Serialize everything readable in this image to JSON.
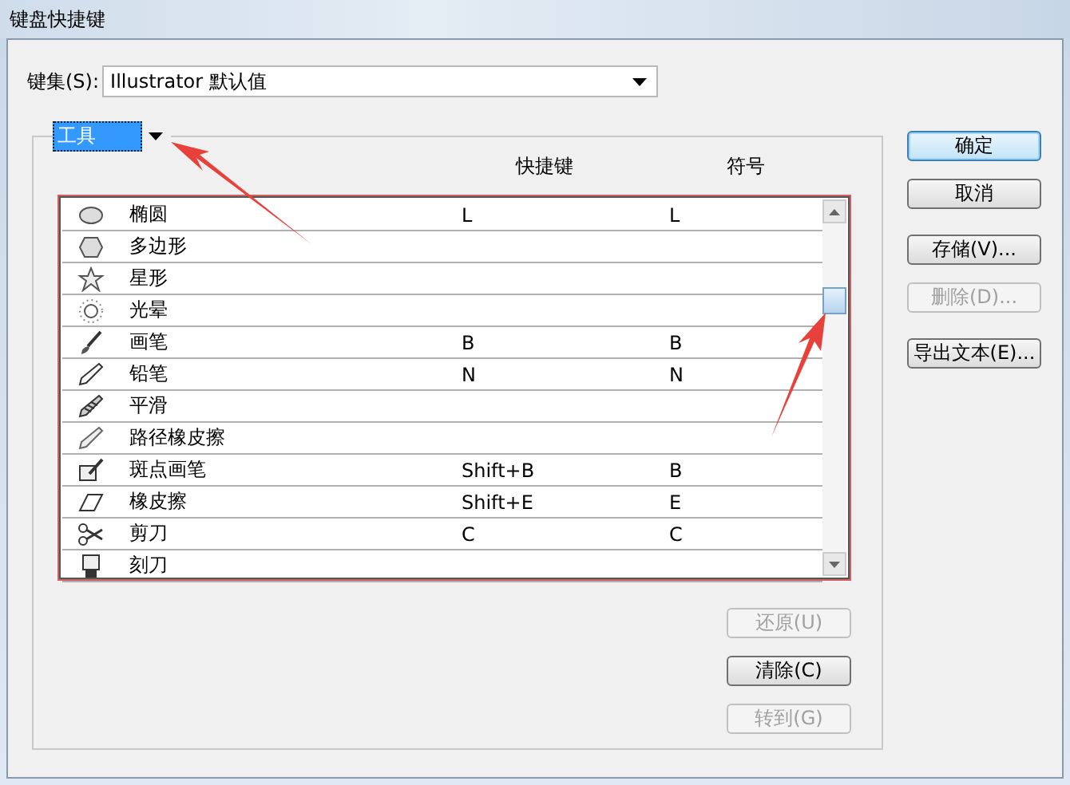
{
  "window": {
    "title": "键盘快捷键"
  },
  "keyset": {
    "label": "键集(S):",
    "value": "Illustrator 默认值"
  },
  "category": {
    "value": "工具"
  },
  "columns": [
    "快捷键",
    "符号"
  ],
  "rows": [
    {
      "name": "椭圆",
      "shortcut": "L",
      "symbol": "L"
    },
    {
      "name": "多边形",
      "shortcut": "",
      "symbol": ""
    },
    {
      "name": "星形",
      "shortcut": "",
      "symbol": ""
    },
    {
      "name": "光晕",
      "shortcut": "",
      "symbol": ""
    },
    {
      "name": "画笔",
      "shortcut": "B",
      "symbol": "B"
    },
    {
      "name": "铅笔",
      "shortcut": "N",
      "symbol": "N"
    },
    {
      "name": "平滑",
      "shortcut": "",
      "symbol": ""
    },
    {
      "name": "路径橡皮擦",
      "shortcut": "",
      "symbol": ""
    },
    {
      "name": "斑点画笔",
      "shortcut": "Shift+B",
      "symbol": "B"
    },
    {
      "name": "橡皮擦",
      "shortcut": "Shift+E",
      "symbol": "E"
    },
    {
      "name": "剪刀",
      "shortcut": "C",
      "symbol": "C"
    },
    {
      "name": "刻刀",
      "shortcut": "",
      "symbol": ""
    }
  ],
  "side_buttons": [
    {
      "label": "确定",
      "disabled": false,
      "default": true
    },
    {
      "label": "取消",
      "disabled": false,
      "default": false
    },
    {
      "label": "存储(V)...",
      "disabled": false,
      "default": false
    },
    {
      "label": "删除(D)...",
      "disabled": true,
      "default": false
    },
    {
      "label": "导出文本(E)...",
      "disabled": false,
      "default": false
    }
  ],
  "bottom_buttons": [
    {
      "label": "还原(U)",
      "disabled": true
    },
    {
      "label": "清除(C)",
      "disabled": false
    },
    {
      "label": "转到(G)",
      "disabled": true
    }
  ]
}
